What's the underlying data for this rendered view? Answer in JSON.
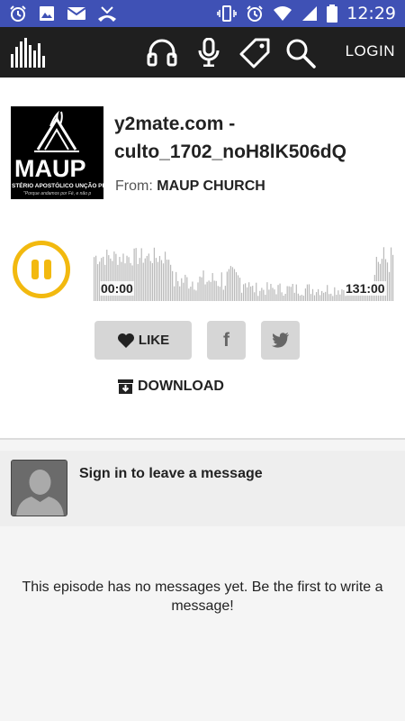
{
  "status_bar": {
    "time": "12:29",
    "icons": [
      "alarm-icon",
      "image-icon",
      "mail-icon",
      "missed-call-icon",
      "vibrate-icon",
      "alarm-icon",
      "wifi-icon",
      "signal-icon",
      "battery-icon"
    ]
  },
  "app_bar": {
    "logo_icon": "equalizer-logo-icon",
    "icons": [
      "headphones-icon",
      "microphone-icon",
      "tag-icon",
      "search-icon"
    ],
    "login_label": "LOGIN"
  },
  "episode": {
    "title": "y2mate.com - culto_1702_noH8lK506dQ",
    "from_label": "From:",
    "author": "MAUP CHURCH",
    "cover_text": "MAUP",
    "cover_subtext": "STÉRIO APOSTÓLICO UNÇÃO PRO",
    "cover_tagline": "\"Porque andamos por Fé, e não p",
    "time_start": "00:00",
    "time_end": "131:00",
    "play_state": "playing"
  },
  "actions": {
    "like_label": "LIKE",
    "facebook_glyph": "f",
    "download_label": "DOWNLOAD"
  },
  "comments": {
    "signin_label": "Sign in to leave a message",
    "empty_message": "This episode has no messages yet. Be the first to write a message!"
  },
  "colors": {
    "status_bar": "#3f51b5",
    "app_bar": "#1f1f1f",
    "accent": "#f2b90f",
    "button_bg": "#d6d6d6"
  }
}
